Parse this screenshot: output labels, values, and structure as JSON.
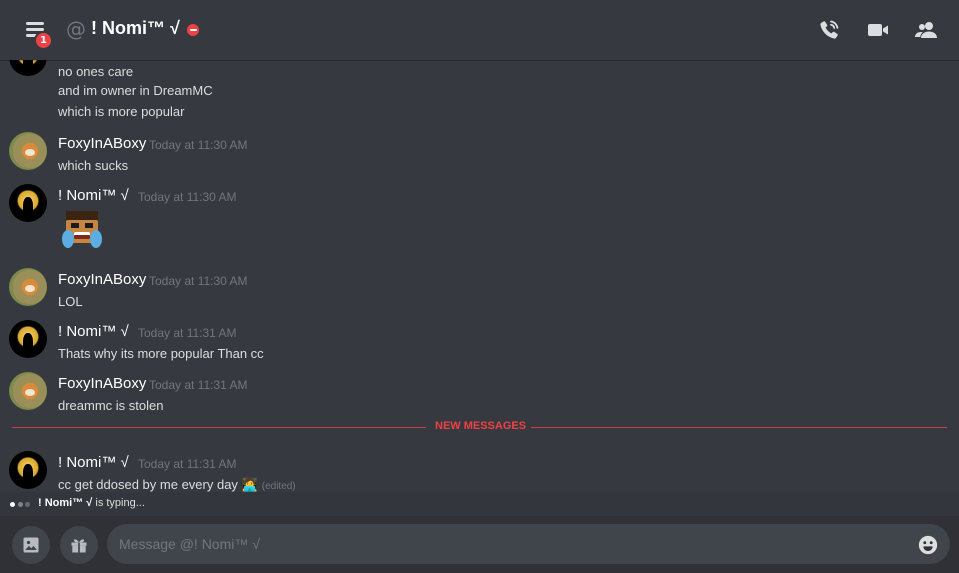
{
  "header": {
    "badge_count": "1",
    "title": "! Nomi™ √"
  },
  "messages": [
    {
      "lines": [
        "no ones care",
        "and im owner in DreamMC",
        "which is more popular"
      ]
    },
    {
      "author": "FoxyInABoxy",
      "timestamp": "Today at 11:30 AM",
      "text": "which sucks"
    },
    {
      "author": "! Nomi™ √",
      "timestamp": "Today at 11:30 AM",
      "emoji": "crying-laughing-emoji"
    },
    {
      "author": "FoxyInABoxy",
      "timestamp": "Today at 11:30 AM",
      "text": "LOL"
    },
    {
      "author": "! Nomi™ √",
      "timestamp": "Today at 11:31 AM",
      "text": "Thats why its more popular Than cc"
    },
    {
      "author": "FoxyInABoxy",
      "timestamp": "Today at 11:31 AM",
      "text": "dreammc is stolen"
    },
    {
      "author": "! Nomi™ √",
      "timestamp": "Today at 11:31 AM",
      "text": "cc get ddosed by me every day 🧑‍💻",
      "edited": "(edited)"
    }
  ],
  "divider": {
    "label": "NEW MESSAGES"
  },
  "typing": {
    "user": "! Nomi™ √",
    "suffix": " is typing..."
  },
  "composer": {
    "placeholder": "Message @! Nomi™ √"
  },
  "colors": {
    "background": "#36393f",
    "accent_red": "#ed4245",
    "input": "#40444b"
  },
  "icons": [
    "hamburger-menu-icon",
    "at-icon",
    "dnd-status-icon",
    "phone-call-icon",
    "video-camera-icon",
    "member-list-icon",
    "image-upload-icon",
    "gift-icon",
    "emoji-picker-icon"
  ]
}
